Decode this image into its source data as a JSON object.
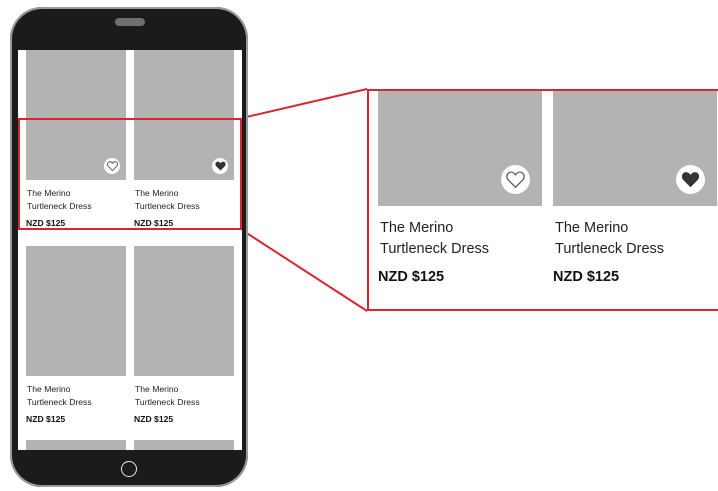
{
  "products": [
    {
      "name_line1": "The Merino",
      "name_line2": "Turtleneck Dress",
      "price": "NZD $125",
      "favorite": false
    },
    {
      "name_line1": "The Merino",
      "name_line2": "Turtleneck Dress",
      "price": "NZD $125",
      "favorite": true
    },
    {
      "name_line1": "The Merino",
      "name_line2": "Turtleneck Dress",
      "price": "NZD $125"
    },
    {
      "name_line1": "The Merino",
      "name_line2": "Turtleneck Dress",
      "price": "NZD $125"
    }
  ],
  "zoom": [
    {
      "name_line1": "The Merino",
      "name_line2": "Turtleneck Dress",
      "price": "NZD $125",
      "favorite": false
    },
    {
      "name_line1": "The Merino",
      "name_line2": "Turtleneck Dress",
      "price": "NZD $125",
      "favorite": true
    }
  ],
  "colors": {
    "highlight": "#d7262e",
    "placeholder": "#b3b3b3",
    "device": "#1b1b1b"
  },
  "icons": {
    "favorite_off": "heart-outline-icon",
    "favorite_on": "heart-filled-icon"
  }
}
